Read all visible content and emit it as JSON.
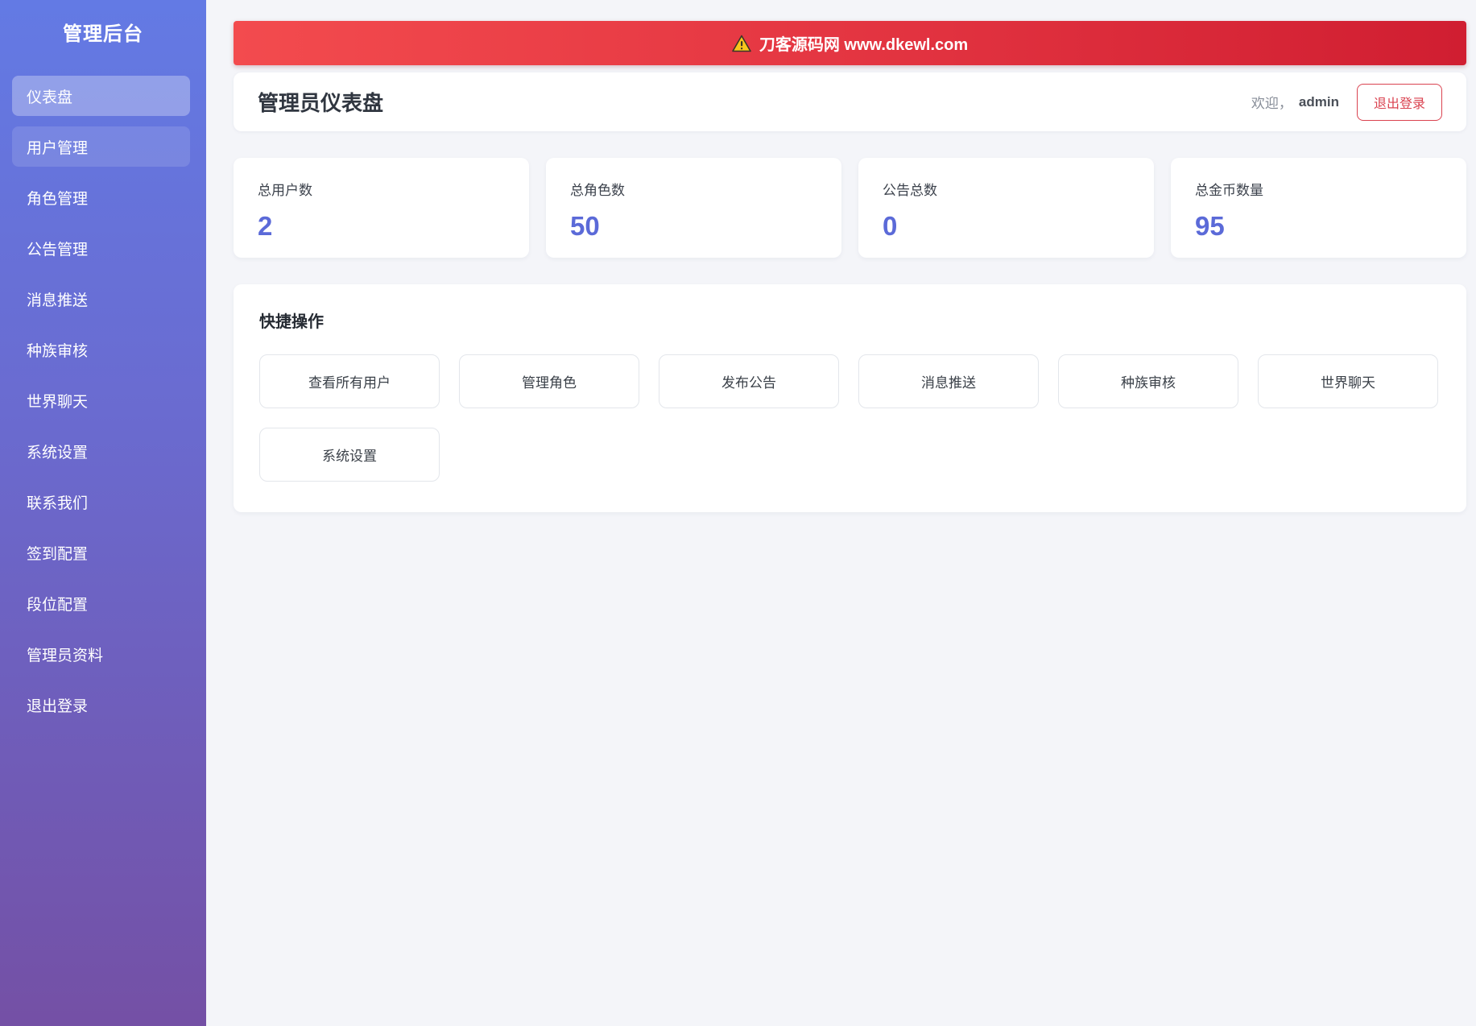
{
  "sidebar": {
    "title": "管理后台",
    "items": [
      {
        "label": "仪表盘"
      },
      {
        "label": "用户管理"
      },
      {
        "label": "角色管理"
      },
      {
        "label": "公告管理"
      },
      {
        "label": "消息推送"
      },
      {
        "label": "种族审核"
      },
      {
        "label": "世界聊天"
      },
      {
        "label": "系统设置"
      },
      {
        "label": "联系我们"
      },
      {
        "label": "签到配置"
      },
      {
        "label": "段位配置"
      },
      {
        "label": "管理员资料"
      },
      {
        "label": "退出登录"
      }
    ]
  },
  "banner": {
    "icon": "warning-icon",
    "text": "刀客源码网 www.dkewl.com"
  },
  "header": {
    "title": "管理员仪表盘",
    "welcome_prefix": "欢迎，",
    "username": "admin",
    "logout_label": "退出登录"
  },
  "stats": [
    {
      "label": "总用户数",
      "value": "2"
    },
    {
      "label": "总角色数",
      "value": "50"
    },
    {
      "label": "公告总数",
      "value": "0"
    },
    {
      "label": "总金币数量",
      "value": "95"
    }
  ],
  "quick_actions": {
    "title": "快捷操作",
    "buttons": [
      "查看所有用户",
      "管理角色",
      "发布公告",
      "消息推送",
      "种族审核",
      "世界聊天",
      "系统设置"
    ]
  },
  "colors": {
    "accent_indigo": "#5b6ad8",
    "banner_red_left": "#f34b4e",
    "banner_red_right": "#d01e31",
    "logout_red": "#da4350",
    "sidebar_gradient_top": "#637ae4",
    "sidebar_gradient_bottom": "#7450a5",
    "page_background": "#f4f5f9"
  }
}
